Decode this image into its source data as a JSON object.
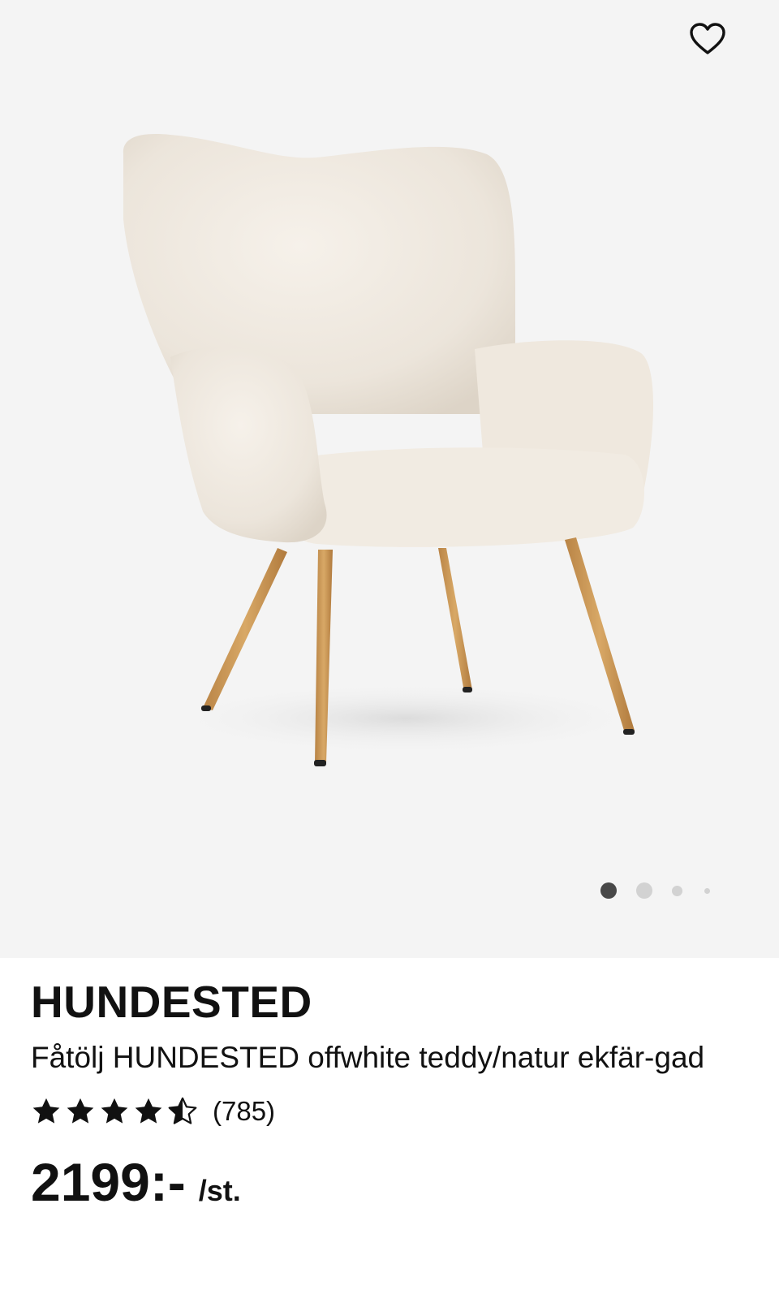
{
  "gallery": {
    "favorite_icon": "heart-outline-icon",
    "image_description": "white teddy armchair with oak-colored legs",
    "slide_count": 4,
    "active_slide": 1
  },
  "product": {
    "brand": "HUNDESTED",
    "description": "Fåtölj HUNDESTED offwhite teddy/natur ekfär-gad",
    "rating": 4.5,
    "rating_max": 5,
    "review_count": "(785)",
    "price": "2199:-",
    "unit": "/st."
  },
  "colors": {
    "gallery_bg": "#f4f4f4",
    "text": "#111111",
    "dot_active": "#484848",
    "dot_inactive": "#d2d2d2"
  }
}
